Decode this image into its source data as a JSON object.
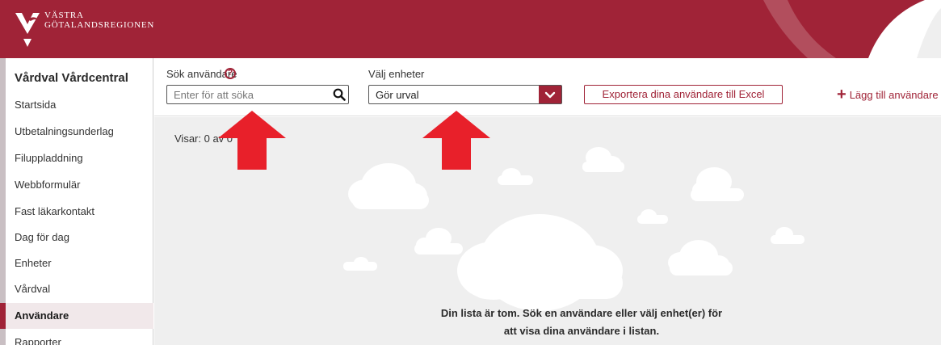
{
  "header": {
    "logo_line1": "VÄSTRA",
    "logo_line2": "GÖTALANDSREGIONEN",
    "brand_color": "#a02337"
  },
  "sidebar": {
    "title": "Vårdval Vårdcentral",
    "items": [
      {
        "label": "Startsida"
      },
      {
        "label": "Utbetalningsunderlag"
      },
      {
        "label": "Filuppladdning"
      },
      {
        "label": "Webbformulär"
      },
      {
        "label": "Fast läkarkontakt"
      },
      {
        "label": "Dag för dag"
      },
      {
        "label": "Enheter"
      },
      {
        "label": "Vårdval"
      },
      {
        "label": "Användare"
      },
      {
        "label": "Rapporter"
      }
    ],
    "active_item": "Användare"
  },
  "filters": {
    "search_label": "Sök användare",
    "search_placeholder": "Enter för att söka",
    "search_value": "",
    "unit_label": "Välj enheter",
    "unit_value": "Gör urval"
  },
  "actions": {
    "export_label": "Exportera dina användare till Excel",
    "add_user_label": "Lägg till användare"
  },
  "main": {
    "count_text": "Visar: 0 av 0",
    "empty_line1": "Din lista är tom. Sök en användare eller välj enhet(er) för",
    "empty_line2": "att visa dina användare i listan."
  },
  "icons": {
    "search": "search-icon",
    "help": "help-icon",
    "chevron": "chevron-down-icon",
    "plus": "plus-icon",
    "annotation_arrow_color": "#e8202a"
  }
}
